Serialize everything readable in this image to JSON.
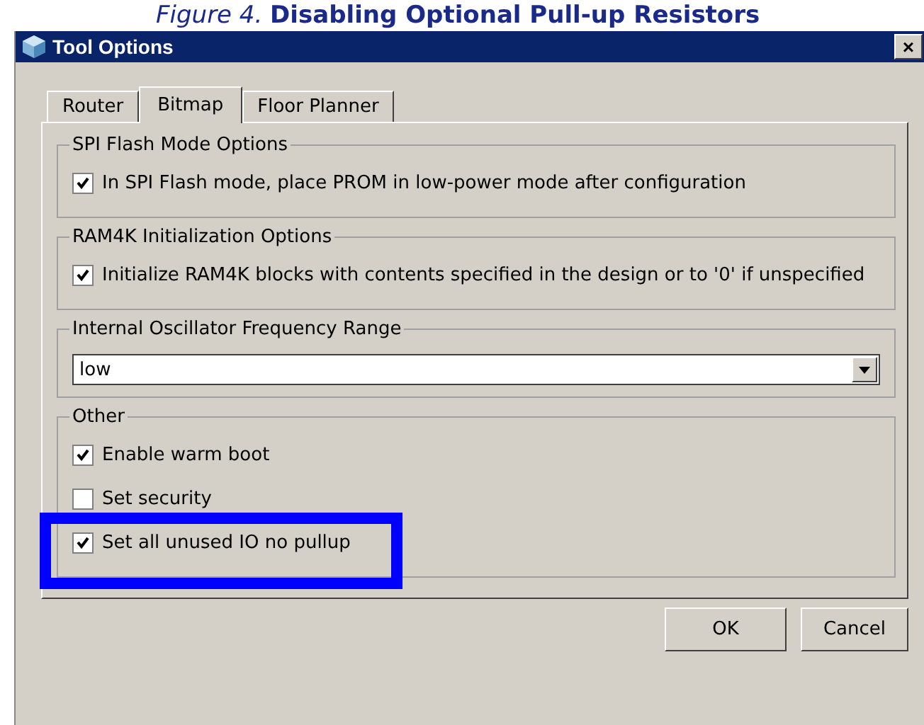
{
  "caption": "*Figure 4.* **Disabling Optional Pull-up Resistors**",
  "window": {
    "title": "Tool Options",
    "close": "×"
  },
  "tabs": [
    {
      "label": "Router",
      "selected": false
    },
    {
      "label": "Bitmap",
      "selected": true
    },
    {
      "label": "Floor Planner",
      "selected": false
    }
  ],
  "groups": [
    {
      "title": "SPI Flash Mode Options",
      "kind": "checks",
      "options": [
        {
          "label": "In SPI Flash mode, place PROM in low-power mode after configuration",
          "checked": true,
          "highlighted": false
        }
      ]
    },
    {
      "title": "RAM4K Initialization Options",
      "kind": "checks",
      "options": [
        {
          "label": "Initialize RAM4K blocks with contents specified in the design or to '0' if unspecified",
          "checked": true,
          "highlighted": false
        }
      ]
    },
    {
      "title": "Internal Oscillator Frequency Range",
      "kind": "dropdown",
      "value": "low"
    },
    {
      "title": "Other",
      "kind": "checks",
      "options": [
        {
          "label": "Enable warm boot",
          "checked": true,
          "highlighted": false
        },
        {
          "label": "Set security",
          "checked": false,
          "highlighted": false
        },
        {
          "label": "Set all unused IO no pullup",
          "checked": true,
          "highlighted": true
        }
      ]
    }
  ],
  "buttons": [
    "OK",
    "Cancel"
  ]
}
